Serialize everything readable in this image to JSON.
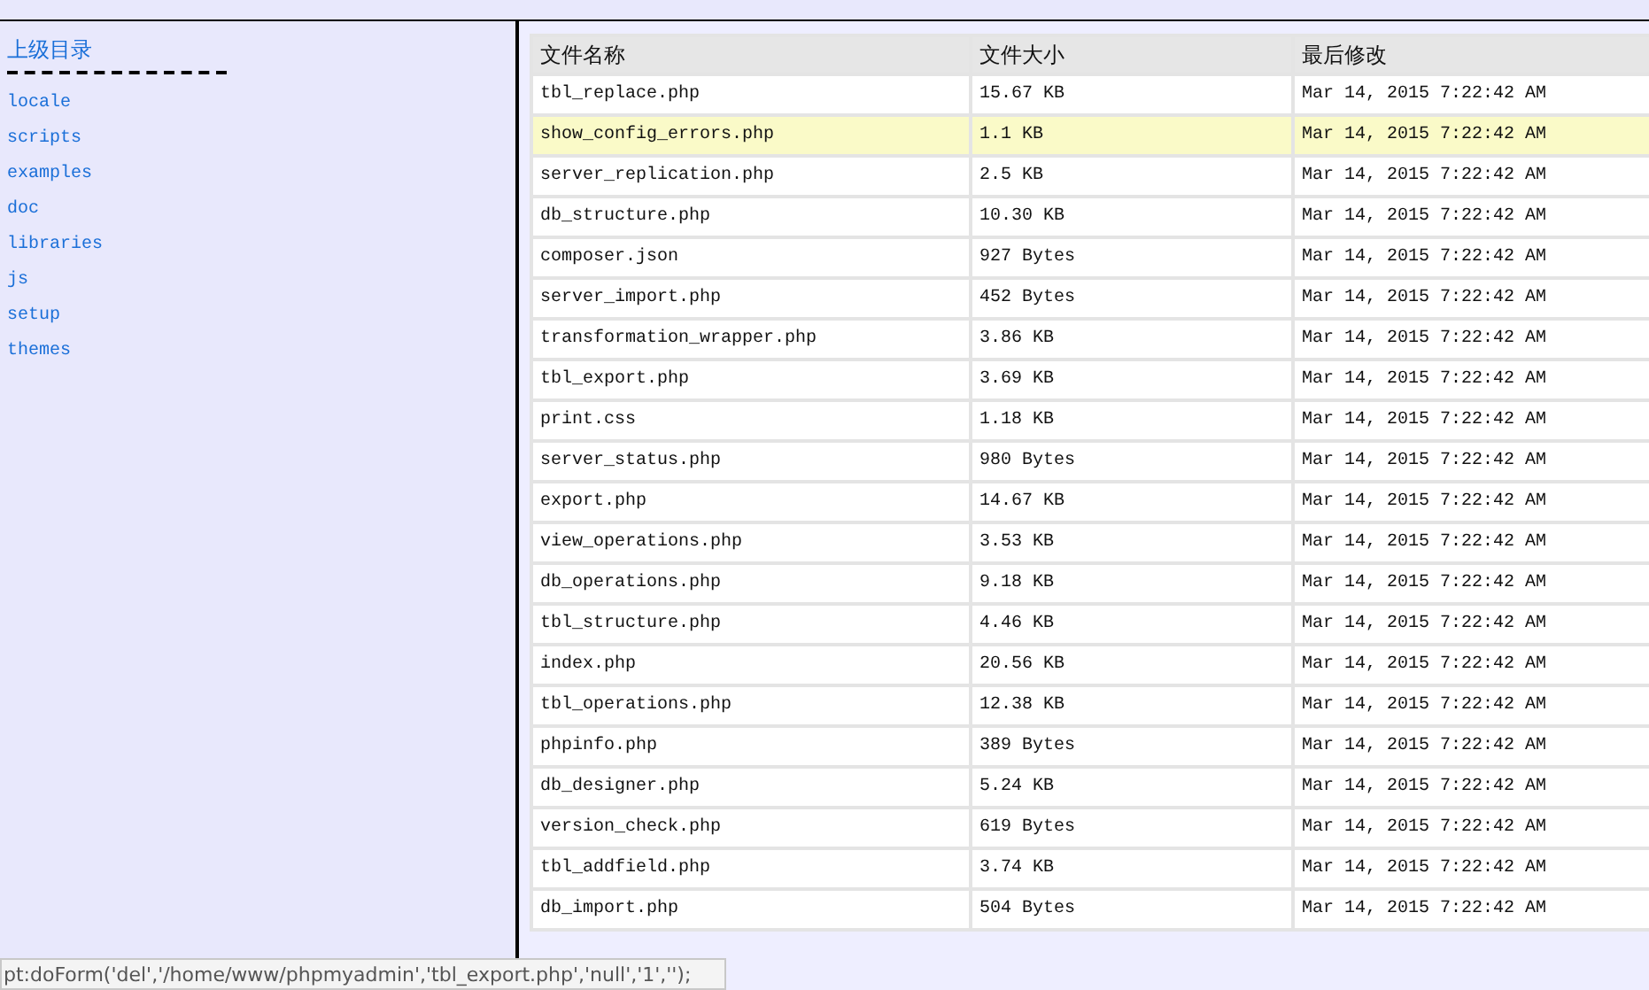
{
  "sidebar": {
    "parent_link": "上级目录",
    "items": [
      "locale",
      "scripts",
      "examples",
      "doc",
      "libraries",
      "js",
      "setup",
      "themes"
    ]
  },
  "table": {
    "columns": [
      "文件名称",
      "文件大小",
      "最后修改"
    ],
    "rows": [
      {
        "name": "tbl_replace.php",
        "size": "15.67 KB",
        "modified": "Mar 14, 2015 7:22:42 AM",
        "selected": false
      },
      {
        "name": "show_config_errors.php",
        "size": "1.1 KB",
        "modified": "Mar 14, 2015 7:22:42 AM",
        "selected": true
      },
      {
        "name": "server_replication.php",
        "size": "2.5 KB",
        "modified": "Mar 14, 2015 7:22:42 AM",
        "selected": false
      },
      {
        "name": "db_structure.php",
        "size": "10.30 KB",
        "modified": "Mar 14, 2015 7:22:42 AM",
        "selected": false
      },
      {
        "name": "composer.json",
        "size": "927 Bytes",
        "modified": "Mar 14, 2015 7:22:42 AM",
        "selected": false
      },
      {
        "name": "server_import.php",
        "size": "452 Bytes",
        "modified": "Mar 14, 2015 7:22:42 AM",
        "selected": false
      },
      {
        "name": "transformation_wrapper.php",
        "size": "3.86 KB",
        "modified": "Mar 14, 2015 7:22:42 AM",
        "selected": false
      },
      {
        "name": "tbl_export.php",
        "size": "3.69 KB",
        "modified": "Mar 14, 2015 7:22:42 AM",
        "selected": false
      },
      {
        "name": "print.css",
        "size": "1.18 KB",
        "modified": "Mar 14, 2015 7:22:42 AM",
        "selected": false
      },
      {
        "name": "server_status.php",
        "size": "980 Bytes",
        "modified": "Mar 14, 2015 7:22:42 AM",
        "selected": false
      },
      {
        "name": "export.php",
        "size": "14.67 KB",
        "modified": "Mar 14, 2015 7:22:42 AM",
        "selected": false
      },
      {
        "name": "view_operations.php",
        "size": "3.53 KB",
        "modified": "Mar 14, 2015 7:22:42 AM",
        "selected": false
      },
      {
        "name": "db_operations.php",
        "size": "9.18 KB",
        "modified": "Mar 14, 2015 7:22:42 AM",
        "selected": false
      },
      {
        "name": "tbl_structure.php",
        "size": "4.46 KB",
        "modified": "Mar 14, 2015 7:22:42 AM",
        "selected": false
      },
      {
        "name": "index.php",
        "size": "20.56 KB",
        "modified": "Mar 14, 2015 7:22:42 AM",
        "selected": false
      },
      {
        "name": "tbl_operations.php",
        "size": "12.38 KB",
        "modified": "Mar 14, 2015 7:22:42 AM",
        "selected": false
      },
      {
        "name": "phpinfo.php",
        "size": "389 Bytes",
        "modified": "Mar 14, 2015 7:22:42 AM",
        "selected": false
      },
      {
        "name": "db_designer.php",
        "size": "5.24 KB",
        "modified": "Mar 14, 2015 7:22:42 AM",
        "selected": false
      },
      {
        "name": "version_check.php",
        "size": "619 Bytes",
        "modified": "Mar 14, 2015 7:22:42 AM",
        "selected": false
      },
      {
        "name": "tbl_addfield.php",
        "size": "3.74 KB",
        "modified": "Mar 14, 2015 7:22:42 AM",
        "selected": false
      },
      {
        "name": "db_import.php",
        "size": "504 Bytes",
        "modified": "Mar 14, 2015 7:22:42 AM",
        "selected": false
      }
    ]
  },
  "status_bar": "pt:doForm('del','/home/www/phpmyadmin','tbl_export.php','null','1','');"
}
